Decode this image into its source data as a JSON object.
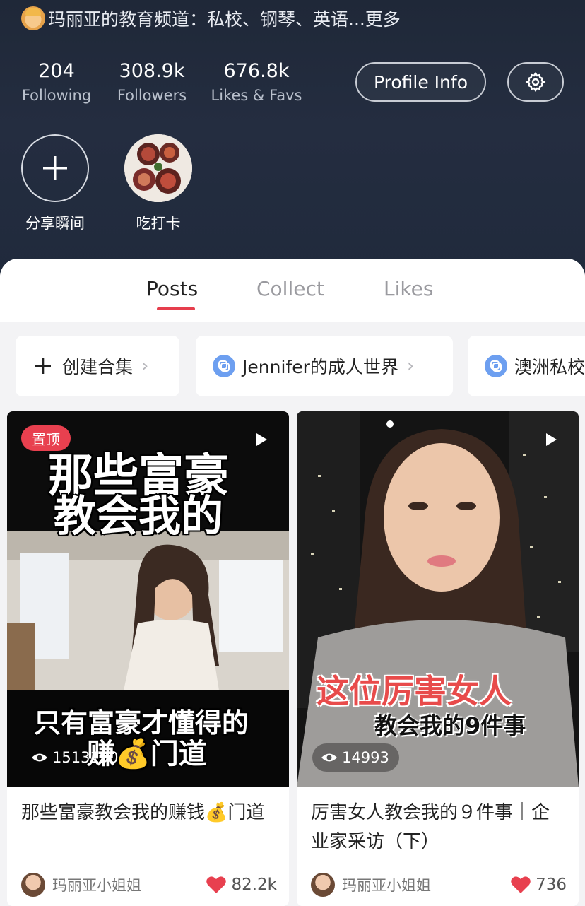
{
  "profile": {
    "bio": "玛丽亚的教育频道：私校、钢琴、英语...更多",
    "stats": {
      "following": {
        "value": "204",
        "label": "Following"
      },
      "followers": {
        "value": "308.9k",
        "label": "Followers"
      },
      "likes": {
        "value": "676.8k",
        "label": "Likes & Favs"
      }
    },
    "profile_info_label": "Profile Info",
    "moments": [
      {
        "label": "分享瞬间",
        "icon": "plus-icon"
      },
      {
        "label": "吃打卡",
        "icon": "food-thumbnail"
      }
    ]
  },
  "tabs": {
    "posts": "Posts",
    "collect": "Collect",
    "likes": "Likes"
  },
  "collections": {
    "create": "创建合集",
    "items": [
      "Jennifer的成人世界",
      "澳洲私校"
    ]
  },
  "posts": [
    {
      "pinned": "置顶",
      "overlay_lines": [
        "那些富豪",
        "教会我的",
        "只有富豪才懂得的",
        "赚💰门道"
      ],
      "views": "1513190",
      "title": "那些富豪教会我的赚钱💰门道",
      "author": "玛丽亚小姐姐",
      "likes": "82.2k"
    },
    {
      "overlay_lines": [
        "这位厉害女人",
        "教会我的9件事"
      ],
      "views": "14993",
      "title": "厉害女人教会我的９件事｜企业家采访（下）",
      "author": "玛丽亚小姐姐",
      "likes": "736"
    }
  ],
  "colors": {
    "header_bg": "#222b3d",
    "accent": "#e63e4d",
    "heart": "#e8404f",
    "collection_icon": "#6d9ff0"
  }
}
